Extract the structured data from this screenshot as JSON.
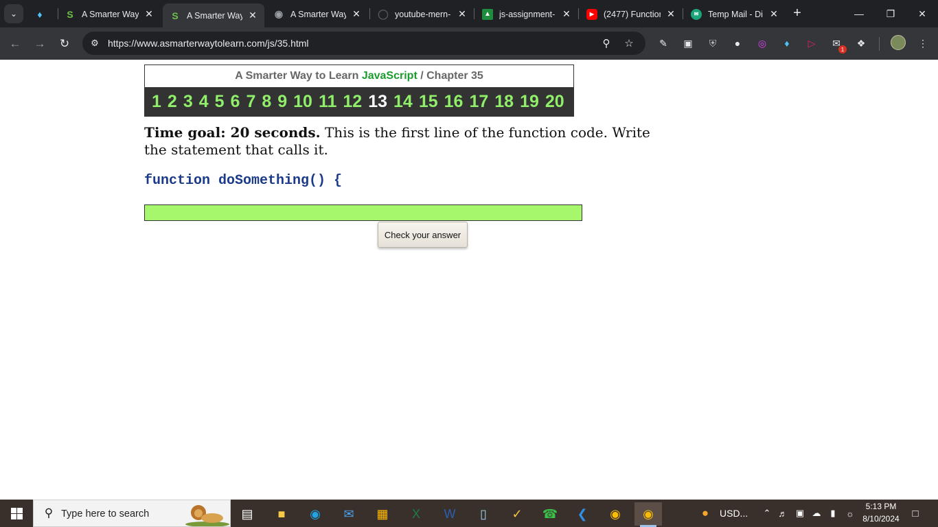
{
  "browser": {
    "tabs": [
      {
        "title": "",
        "favicon": "gem-icon",
        "active": false
      },
      {
        "title": "A Smarter Way",
        "favicon": "smarter-way-icon",
        "active": false
      },
      {
        "title": "A Smarter Way",
        "favicon": "smarter-way-icon",
        "active": true
      },
      {
        "title": "A Smarter Way",
        "favicon": "globe-icon",
        "active": false
      },
      {
        "title": "youtube-mern-",
        "favicon": "github-icon",
        "active": false
      },
      {
        "title": "js-assignment-",
        "favicon": "classroom-icon",
        "active": false
      },
      {
        "title": "(2477) Function",
        "favicon": "youtube-icon",
        "active": false
      },
      {
        "title": "Temp Mail - Di",
        "favicon": "tempmail-icon",
        "active": false
      }
    ],
    "url": "https://www.asmarterwaytolearn.com/js/35.html",
    "extension_badge": "1"
  },
  "page": {
    "header": {
      "prefix": "A Smarter Way to Learn ",
      "language": "JavaScript",
      "separator": " / ",
      "chapter": "Chapter 35"
    },
    "exercises": [
      "1",
      "2",
      "3",
      "4",
      "5",
      "6",
      "7",
      "8",
      "9",
      "10",
      "11",
      "12",
      "13",
      "14",
      "15",
      "16",
      "17",
      "18",
      "19",
      "20"
    ],
    "current_exercise": "13",
    "time_goal": "Time goal: 20 seconds.",
    "instruction": " This is the first line of the function code. Write the statement that calls it.",
    "code_line": "function doSomething() {",
    "answer_value": "",
    "check_button": "Check your answer"
  },
  "taskbar": {
    "search_placeholder": "Type here to search",
    "weather_text": "USD...",
    "time": "5:13 PM",
    "date": "8/10/2024"
  },
  "colors": {
    "exercise_link": "#90ee6a",
    "current_exercise": "#ffffff",
    "answer_field": "#a6f76c",
    "javascript_brand": "#1a9b2c",
    "code_text": "#1a3a8a"
  }
}
